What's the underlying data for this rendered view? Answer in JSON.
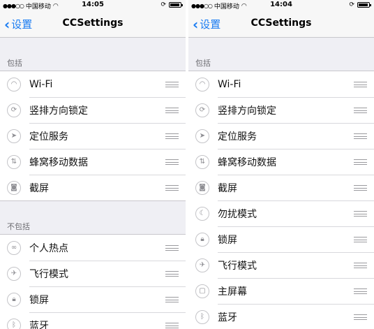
{
  "screens": [
    {
      "status": {
        "carrier": "中国移动",
        "time": "14:05",
        "battery_level": 0.9
      },
      "nav": {
        "back_label": "设置",
        "title": "CCSettings"
      },
      "sections": [
        {
          "header": "包括",
          "items": [
            {
              "label": "Wi-Fi",
              "icon": "wifi-icon"
            },
            {
              "label": "竖排方向锁定",
              "icon": "rotation-lock-icon"
            },
            {
              "label": "定位服务",
              "icon": "location-arrow-icon"
            },
            {
              "label": "蜂窝移动数据",
              "icon": "cellular-data-icon"
            },
            {
              "label": "截屏",
              "icon": "camera-icon"
            }
          ]
        },
        {
          "header": "不包括",
          "items": [
            {
              "label": "个人热点",
              "icon": "link-icon"
            },
            {
              "label": "飞行模式",
              "icon": "airplane-icon"
            },
            {
              "label": "锁屏",
              "icon": "lock-icon"
            },
            {
              "label": "蓝牙",
              "icon": "bluetooth-icon"
            }
          ]
        }
      ]
    },
    {
      "status": {
        "carrier": "中国移动",
        "time": "14:04",
        "battery_level": 0.9
      },
      "nav": {
        "back_label": "设置",
        "title": "CCSettings"
      },
      "sections": [
        {
          "header": "包括",
          "items": [
            {
              "label": "Wi-Fi",
              "icon": "wifi-icon"
            },
            {
              "label": "竖排方向锁定",
              "icon": "rotation-lock-icon"
            },
            {
              "label": "定位服务",
              "icon": "location-arrow-icon"
            },
            {
              "label": "蜂窝移动数据",
              "icon": "cellular-data-icon"
            },
            {
              "label": "截屏",
              "icon": "camera-icon"
            },
            {
              "label": "勿扰模式",
              "icon": "moon-icon"
            },
            {
              "label": "锁屏",
              "icon": "lock-icon"
            },
            {
              "label": "飞行模式",
              "icon": "airplane-icon"
            },
            {
              "label": "主屏幕",
              "icon": "home-button-icon"
            },
            {
              "label": "蓝牙",
              "icon": "bluetooth-icon"
            }
          ]
        }
      ]
    }
  ],
  "colors": {
    "accent": "#1a7cf2",
    "background": "#efeff4",
    "separator": "#c8c7cc",
    "section_text": "#6d6d72"
  }
}
